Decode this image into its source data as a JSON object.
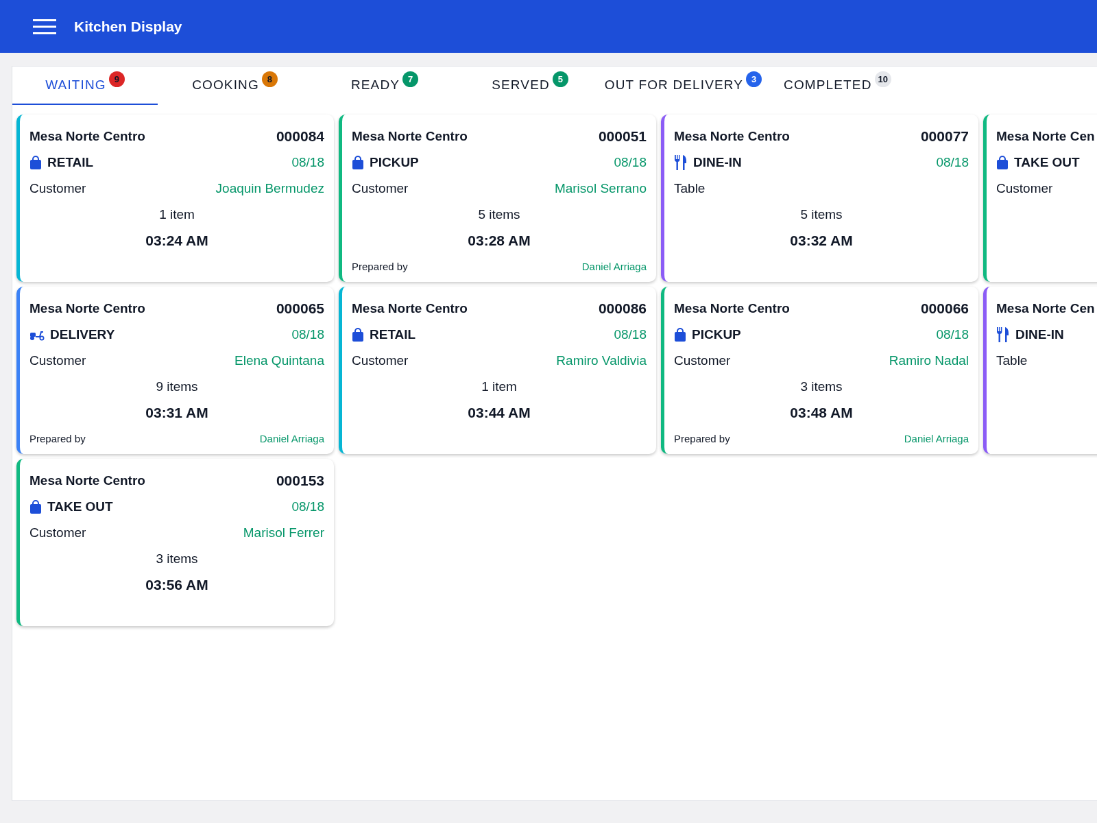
{
  "app_bar": {
    "title": "Kitchen Display"
  },
  "tabs": [
    {
      "label": "WAITING",
      "count": "9",
      "color": "#dc2626",
      "selected": true
    },
    {
      "label": "COOKING",
      "count": "8",
      "color": "#d97706",
      "selected": false
    },
    {
      "label": "READY",
      "count": "7",
      "color": "#059669",
      "selected": false
    },
    {
      "label": "SERVED",
      "count": "5",
      "color": "#059669",
      "selected": false
    },
    {
      "label": "OUT FOR DELIVERY",
      "count": "3",
      "color": "#2563eb",
      "selected": false
    },
    {
      "label": "COMPLETED",
      "count": "10",
      "color": "#e5e7eb",
      "selected": false
    }
  ],
  "orders": [
    {
      "store": "Mesa Norte Centro",
      "number": "000084",
      "kind": "bag",
      "type": "RETAIL",
      "date": "08/18",
      "party_label": "Customer",
      "party_name": "Joaquin Bermudez",
      "items": "1 item",
      "time": "03:24 AM",
      "color": "#06b6d4"
    },
    {
      "store": "Mesa Norte Centro",
      "number": "000051",
      "kind": "bag",
      "type": "PICKUP",
      "date": "08/18",
      "party_label": "Customer",
      "party_name": "Marisol Serrano",
      "items": "5 items",
      "time": "03:28 AM",
      "prepared_label": "Prepared by",
      "prepared_by": "Daniel Arriaga",
      "color": "#10b981"
    },
    {
      "store": "Mesa Norte Centro",
      "number": "000077",
      "kind": "dine",
      "type": "DINE-IN",
      "date": "08/18",
      "party_label": "Table",
      "items": "5 items",
      "time": "03:32 AM",
      "color": "#8b5cf6"
    },
    {
      "store": "Mesa Norte Cen",
      "kind": "bag",
      "type": "TAKE OUT",
      "party_label": "Customer",
      "color": "#10b981"
    },
    {
      "store": "Mesa Norte Centro",
      "number": "000065",
      "kind": "delivery",
      "type": "DELIVERY",
      "date": "08/18",
      "party_label": "Customer",
      "party_name": "Elena Quintana",
      "items": "9 items",
      "time": "03:31 AM",
      "prepared_label": "Prepared by",
      "prepared_by": "Daniel Arriaga",
      "color": "#3b82f6"
    },
    {
      "store": "Mesa Norte Centro",
      "number": "000086",
      "kind": "bag",
      "type": "RETAIL",
      "date": "08/18",
      "party_label": "Customer",
      "party_name": "Ramiro Valdivia",
      "items": "1 item",
      "time": "03:44 AM",
      "color": "#06b6d4"
    },
    {
      "store": "Mesa Norte Centro",
      "number": "000066",
      "kind": "bag",
      "type": "PICKUP",
      "date": "08/18",
      "party_label": "Customer",
      "party_name": "Ramiro Nadal",
      "items": "3 items",
      "time": "03:48 AM",
      "prepared_label": "Prepared by",
      "prepared_by": "Daniel Arriaga",
      "color": "#10b981"
    },
    {
      "store": "Mesa Norte Cen",
      "kind": "dine",
      "type": "DINE-IN",
      "party_label": "Table",
      "color": "#8b5cf6"
    },
    {
      "store": "Mesa Norte Centro",
      "number": "000153",
      "kind": "bag",
      "type": "TAKE OUT",
      "date": "08/18",
      "party_label": "Customer",
      "party_name": "Marisol Ferrer",
      "items": "3 items",
      "time": "03:56 AM",
      "color": "#10b981"
    }
  ]
}
